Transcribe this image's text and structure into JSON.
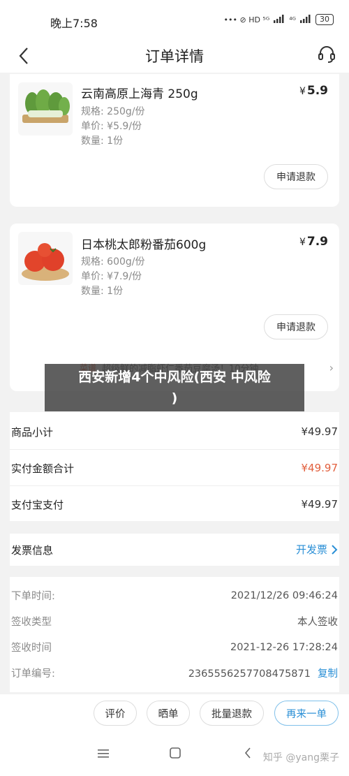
{
  "status_bar": {
    "time": "晚上7:58",
    "indicators": "••• ⊘ HD ⁵ᴳ",
    "network": "⁴ᴳ",
    "battery": "30"
  },
  "nav": {
    "back_icon": "chevron-left-icon",
    "title": "订单详情",
    "service_icon": "headset-icon"
  },
  "products": [
    {
      "name": "云南高原上海青 250g",
      "price_symbol": "¥",
      "price": "5.9",
      "spec": "规格: 250g/份",
      "unit_price": "单价: ¥5.9/份",
      "quantity": "数量: 1份",
      "refund_label": "申请退款",
      "thumb": "bok-choy"
    },
    {
      "name": "日本桃太郎粉番茄600g",
      "price_symbol": "¥",
      "price": "7.9",
      "spec": "规格: 600g/份",
      "unit_price": "单价: ¥7.9/份",
      "quantity": "数量: 1份",
      "refund_label": "申请退款",
      "thumb": "tomato"
    }
  ],
  "promo": {
    "tag": "菜谱",
    "text": "超级鲜的减脂虾仁番茄豆腐汤！10分钟..."
  },
  "overlay": {
    "line1": "西安新增4个中风险(西安 中风险",
    "line2": ")"
  },
  "summary": {
    "subtotal_label": "商品小计",
    "subtotal_value": "¥49.97",
    "paid_label": "实付金额合计",
    "paid_value": "¥49.97",
    "alipay_label": "支付宝支付",
    "alipay_value": "¥49.97"
  },
  "invoice": {
    "label": "发票信息",
    "action": "开发票"
  },
  "order_info": {
    "order_time_label": "下单时间:",
    "order_time": "2021/12/26 09:46:24",
    "receipt_type_label": "签收类型",
    "receipt_type": "本人签收",
    "receipt_time_label": "签收时间",
    "receipt_time": "2021-12-26 17:28:24",
    "order_no_label": "订单编号:",
    "order_no": "2365556257708475871",
    "copy_label": "复制"
  },
  "actions": {
    "review": "评价",
    "share": "晒单",
    "batch_refund": "批量退款",
    "reorder": "再来一单"
  },
  "watermark": "知乎 @yang栗子",
  "colors": {
    "accent_red": "#e2603e",
    "link_blue": "#2a8fd6"
  }
}
